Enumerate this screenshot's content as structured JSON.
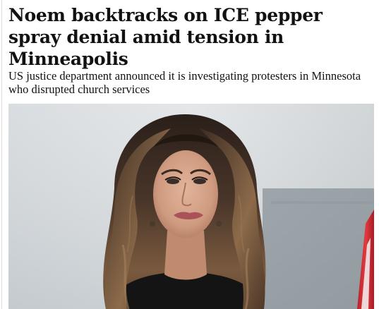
{
  "article": {
    "headline": "Noem backtracks on ICE pepper spray denial amid tension in Minneapolis",
    "standfirst": "US justice department announced it is investigating protesters in Minnesota who disrupted church services"
  },
  "photo": {
    "icon": "portrait-photo"
  },
  "colors": {
    "text": "#121212",
    "background": "#ffffff"
  }
}
